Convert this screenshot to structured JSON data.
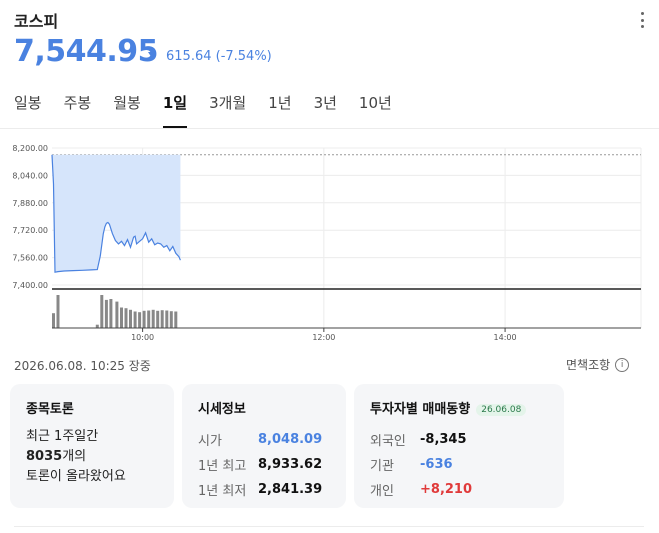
{
  "header": {
    "title": "코스피",
    "price": "7,544.95",
    "change": "615.64 (-7.54%)"
  },
  "tabs": [
    {
      "label": "일봉",
      "active": false
    },
    {
      "label": "주봉",
      "active": false
    },
    {
      "label": "월봉",
      "active": false
    },
    {
      "label": "1일",
      "active": true
    },
    {
      "label": "3개월",
      "active": false
    },
    {
      "label": "1년",
      "active": false
    },
    {
      "label": "3년",
      "active": false
    },
    {
      "label": "10년",
      "active": false
    }
  ],
  "colors": {
    "accent_blue": "#4a82e0",
    "down_red": "#e03a3a",
    "area_fill": "#d6e5fb",
    "volume_bar": "#888888"
  },
  "chart_data": {
    "type": "area",
    "ylim": [
      7400,
      8200
    ],
    "y_ticks": [
      "8,200.00",
      "8,040.00",
      "7,880.00",
      "7,720.00",
      "7,560.00",
      "7,400.00"
    ],
    "x_ticks": [
      {
        "label": "10:00",
        "minute": 60
      },
      {
        "label": "12:00",
        "minute": 180
      },
      {
        "label": "14:00",
        "minute": 300
      }
    ],
    "session_minutes": 390,
    "previous_close": 8160.59,
    "filled_until_minute": 85,
    "x": [
      0,
      1,
      2,
      4,
      8,
      14,
      20,
      26,
      30,
      32,
      34,
      35,
      36,
      37,
      38,
      40,
      42,
      44,
      46,
      48,
      50,
      52,
      54,
      55,
      56,
      58,
      60,
      62,
      64,
      66,
      68,
      70,
      72,
      74,
      76,
      78,
      80,
      82,
      84,
      85
    ],
    "y": [
      8160,
      7990,
      7475,
      7478,
      7482,
      7484,
      7486,
      7488,
      7490,
      7570,
      7700,
      7740,
      7760,
      7765,
      7755,
      7700,
      7660,
      7640,
      7655,
      7630,
      7665,
      7620,
      7680,
      7685,
      7640,
      7655,
      7670,
      7705,
      7650,
      7670,
      7635,
      7645,
      7640,
      7620,
      7630,
      7600,
      7625,
      7585,
      7565,
      7545
    ],
    "volume": {
      "max": 100,
      "x": [
        1,
        4,
        30,
        33,
        36,
        39,
        43,
        46,
        49,
        52,
        55,
        58,
        61,
        64,
        67,
        70,
        73,
        76,
        79,
        82
      ],
      "values": [
        45,
        100,
        10,
        100,
        85,
        88,
        80,
        62,
        60,
        55,
        50,
        48,
        52,
        53,
        55,
        52,
        54,
        53,
        51,
        50
      ]
    }
  },
  "footer": {
    "timestamp": "2026.06.08. 10:25 장중",
    "disclaimer": "면책조항",
    "info_icon": "i"
  },
  "cards": {
    "discussion": {
      "title": "종목토론",
      "line1": "최근 1주일간",
      "line2_count": "8035",
      "line2_suffix": "개의",
      "line3": "토론이 올라왔어요"
    },
    "market_info": {
      "title": "시세정보",
      "rows": [
        {
          "label": "시가",
          "value": "8,048.09"
        },
        {
          "label": "1년 최고",
          "value": "8,933.62"
        },
        {
          "label": "1년 최저",
          "value": "2,841.39"
        }
      ]
    },
    "investor": {
      "title": "투자자별 매매동향",
      "date": "26.06.08",
      "rows": [
        {
          "label": "외국인",
          "value": "-8,345"
        },
        {
          "label": "기관",
          "value": "-636"
        },
        {
          "label": "개인",
          "value": "+8,210"
        }
      ]
    }
  }
}
